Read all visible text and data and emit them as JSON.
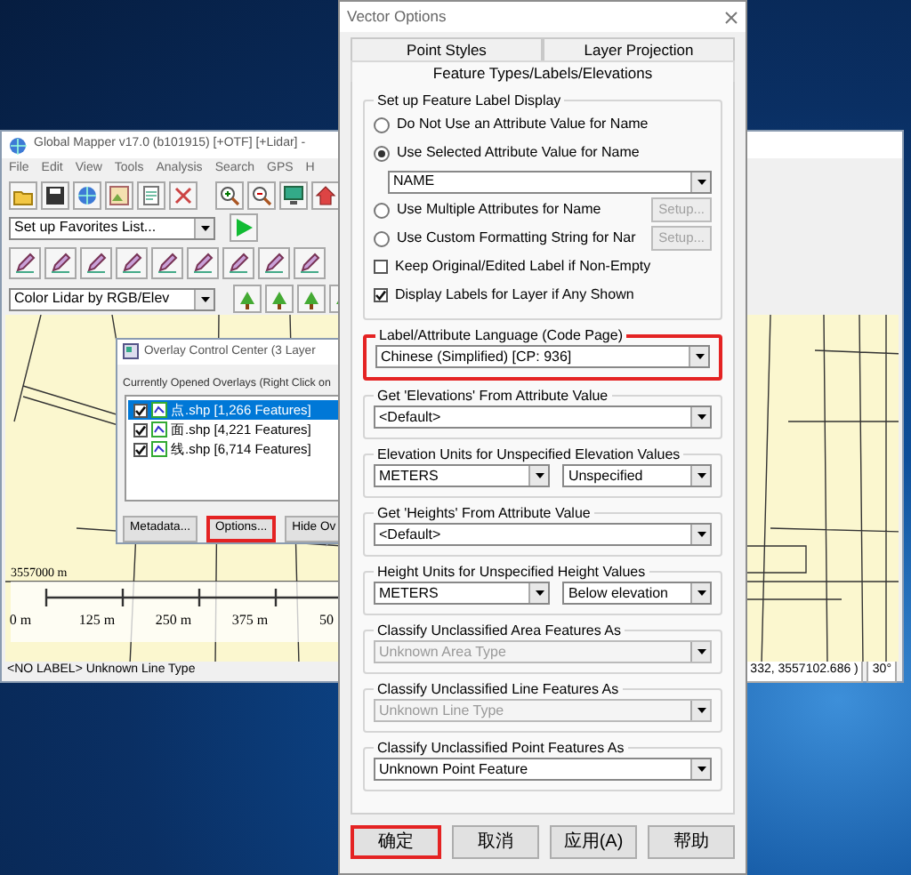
{
  "main_window": {
    "title": "Global Mapper v17.0 (b101915) [+OTF] [+Lidar] -",
    "menu": [
      "File",
      "Edit",
      "View",
      "Tools",
      "Analysis",
      "Search",
      "GPS",
      "H"
    ],
    "favorites_dropdown": "Set up Favorites List...",
    "shader_dropdown": "Color Lidar by RGB/Elev",
    "map": {
      "northing_label": "3557000 m",
      "scale_labels": [
        "0 m",
        "125 m",
        "250 m",
        "375 m",
        "50"
      ]
    },
    "status_bar": {
      "message": "<NO LABEL> Unknown Line Type",
      "coordinates": "332, 3557102.686 )",
      "angle": "30°"
    }
  },
  "overlay_window": {
    "title": "Overlay Control Center (3 Layer",
    "list_label": "Currently Opened Overlays (Right Click on",
    "layers": [
      {
        "name": "点.shp [1,266 Features]",
        "checked": true,
        "selected": true
      },
      {
        "name": "面.shp [4,221 Features]",
        "checked": true,
        "selected": false
      },
      {
        "name": "线.shp [6,714 Features]",
        "checked": true,
        "selected": false
      }
    ],
    "buttons": [
      {
        "label": "Metadata...",
        "highlighted": false
      },
      {
        "label": "Options...",
        "highlighted": true
      },
      {
        "label": "Hide Ov",
        "highlighted": false
      }
    ]
  },
  "dialog": {
    "title": "Vector Options",
    "tabs": [
      {
        "label": "Point Styles",
        "selected": false
      },
      {
        "label": "Layer Projection",
        "selected": false
      },
      {
        "label": "Feature Types/Labels/Elevations",
        "selected": true
      }
    ],
    "label_display": {
      "title": "Set up Feature Label Display",
      "options": [
        {
          "kind": "radio",
          "label": "Do Not Use an Attribute Value for Name",
          "checked": false
        },
        {
          "kind": "radio",
          "label": "Use Selected Attribute Value for Name",
          "checked": true
        },
        {
          "kind": "dropdown",
          "value": "NAME"
        },
        {
          "kind": "radio",
          "label": "Use Multiple Attributes for Name",
          "checked": false,
          "button": {
            "label": "Setup...",
            "disabled": true
          }
        },
        {
          "kind": "radio",
          "label": "Use Custom Formatting String for Nar",
          "checked": false,
          "button": {
            "label": "Setup...",
            "disabled": true
          }
        },
        {
          "kind": "checkbox",
          "label": "Keep Original/Edited Label if Non-Empty",
          "checked": false
        },
        {
          "kind": "checkbox",
          "label": "Display Labels for Layer if Any Shown",
          "checked": true
        }
      ]
    },
    "groups": [
      {
        "title": "Label/Attribute Language (Code Page)",
        "highlighted": true,
        "dropdowns": [
          {
            "value": "Chinese (Simplified) [CP: 936]",
            "disabled": false
          }
        ]
      },
      {
        "title": "Get 'Elevations' From Attribute Value",
        "highlighted": false,
        "dropdowns": [
          {
            "value": "<Default>",
            "disabled": false
          }
        ]
      },
      {
        "title": "Elevation Units for Unspecified Elevation Values",
        "highlighted": false,
        "dropdowns": [
          {
            "value": "METERS",
            "disabled": false
          },
          {
            "value": "Unspecified",
            "disabled": false
          }
        ]
      },
      {
        "title": "Get 'Heights' From Attribute Value",
        "highlighted": false,
        "dropdowns": [
          {
            "value": "<Default>",
            "disabled": false
          }
        ]
      },
      {
        "title": "Height Units for Unspecified Height Values",
        "highlighted": false,
        "dropdowns": [
          {
            "value": "METERS",
            "disabled": false
          },
          {
            "value": "Below elevation",
            "disabled": false
          }
        ]
      },
      {
        "title": "Classify Unclassified Area Features As",
        "highlighted": false,
        "dropdowns": [
          {
            "value": "Unknown Area Type",
            "disabled": true
          }
        ]
      },
      {
        "title": "Classify Unclassified Line Features As",
        "highlighted": false,
        "dropdowns": [
          {
            "value": "Unknown Line Type",
            "disabled": true
          }
        ]
      },
      {
        "title": "Classify Unclassified Point Features As",
        "highlighted": false,
        "dropdowns": [
          {
            "value": "Unknown Point Feature",
            "disabled": false
          }
        ]
      }
    ],
    "buttons": [
      {
        "label": "确定",
        "highlighted": true
      },
      {
        "label": "取消",
        "highlighted": false
      },
      {
        "label": "应用(A)",
        "highlighted": false
      },
      {
        "label": "帮助",
        "highlighted": false
      }
    ]
  }
}
